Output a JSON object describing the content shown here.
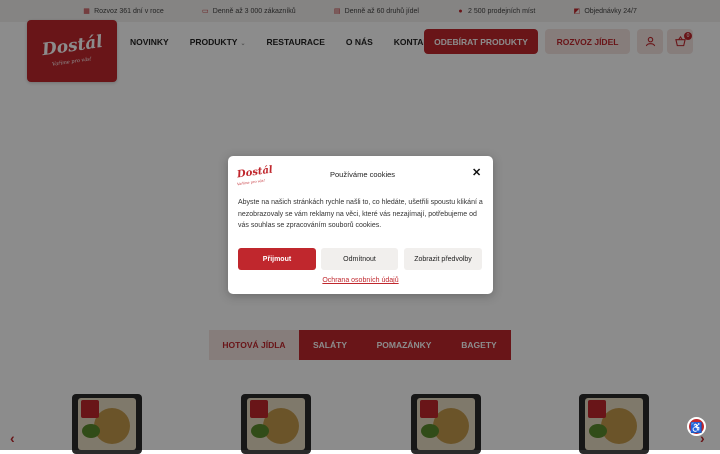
{
  "topbar": {
    "items": [
      {
        "icon": "calendar-icon",
        "glyph": "▦",
        "text": "Rozvoz 361 dní v roce"
      },
      {
        "icon": "truck-icon",
        "glyph": "▭",
        "text": "Denně až 3 000 zákazníků"
      },
      {
        "icon": "menu-card-icon",
        "glyph": "▤",
        "text": "Denně až 60 druhů jídel"
      },
      {
        "icon": "map-pin-icon",
        "glyph": "●",
        "text": "2 500 prodejních míst"
      },
      {
        "icon": "cart-icon",
        "glyph": "◩",
        "text": "Objednávky 24/7"
      }
    ]
  },
  "logo": {
    "brand": "Dostál",
    "tagline": "Vaříme pro vás!"
  },
  "nav": {
    "novinky": "NOVINKY",
    "produkty": "PRODUKTY",
    "restaurace": "RESTAURACE",
    "o_nas": "O NÁS",
    "kontakt": "KONTAKT"
  },
  "header": {
    "odebirat": "ODEBÍRAT PRODUKTY",
    "rozvoz": "ROZVOZ JÍDEL",
    "cart_count": "0"
  },
  "tabs": [
    "HOTOVÁ JÍDLA",
    "SALÁTY",
    "POMAZÁNKY",
    "BAGETY"
  ],
  "cookie": {
    "title": "Používáme cookies",
    "body": "Abyste na našich stránkách rychle našli to, co hledáte, ušetřili spoustu klikání a nezobrazovaly se vám reklamy na věci, které vás nezajímají, potřebujeme od vás souhlas se zpracováním souborů cookies.",
    "accept": "Přijmout",
    "deny": "Odmítnout",
    "preferences": "Zobrazit předvolby",
    "privacy": "Ochrana osobních údajů"
  },
  "colors": {
    "accent": "#c0272d",
    "accent_light": "#f4e4e1"
  }
}
